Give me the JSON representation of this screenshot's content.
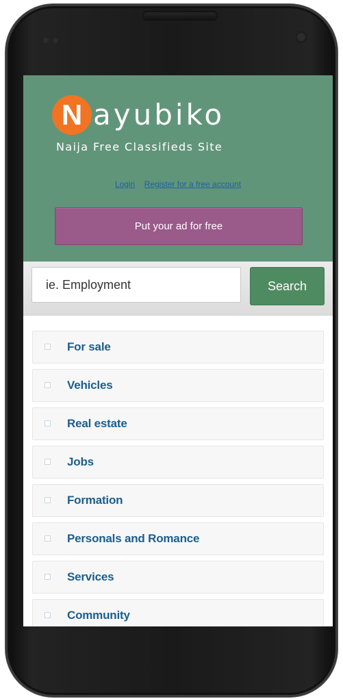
{
  "brand": {
    "logo_initial": "N",
    "logo_rest": "ayubiko",
    "tagline": "Naija Free Classifieds Site"
  },
  "links": {
    "login": "Login",
    "register": "Register for a free account"
  },
  "post_ad_label": "Put your ad for free",
  "search": {
    "placeholder": "ie. Employment",
    "button_label": "Search"
  },
  "categories": [
    {
      "label": "For sale"
    },
    {
      "label": "Vehicles"
    },
    {
      "label": "Real estate"
    },
    {
      "label": "Jobs"
    },
    {
      "label": "Formation"
    },
    {
      "label": "Personals and Romance"
    },
    {
      "label": "Services"
    },
    {
      "label": "Community"
    }
  ],
  "colors": {
    "header_bg": "#61957a",
    "logo_orange": "#f07424",
    "post_button": "#9a5a8a",
    "search_button": "#4f8b61",
    "category_text": "#1b5e8e"
  }
}
